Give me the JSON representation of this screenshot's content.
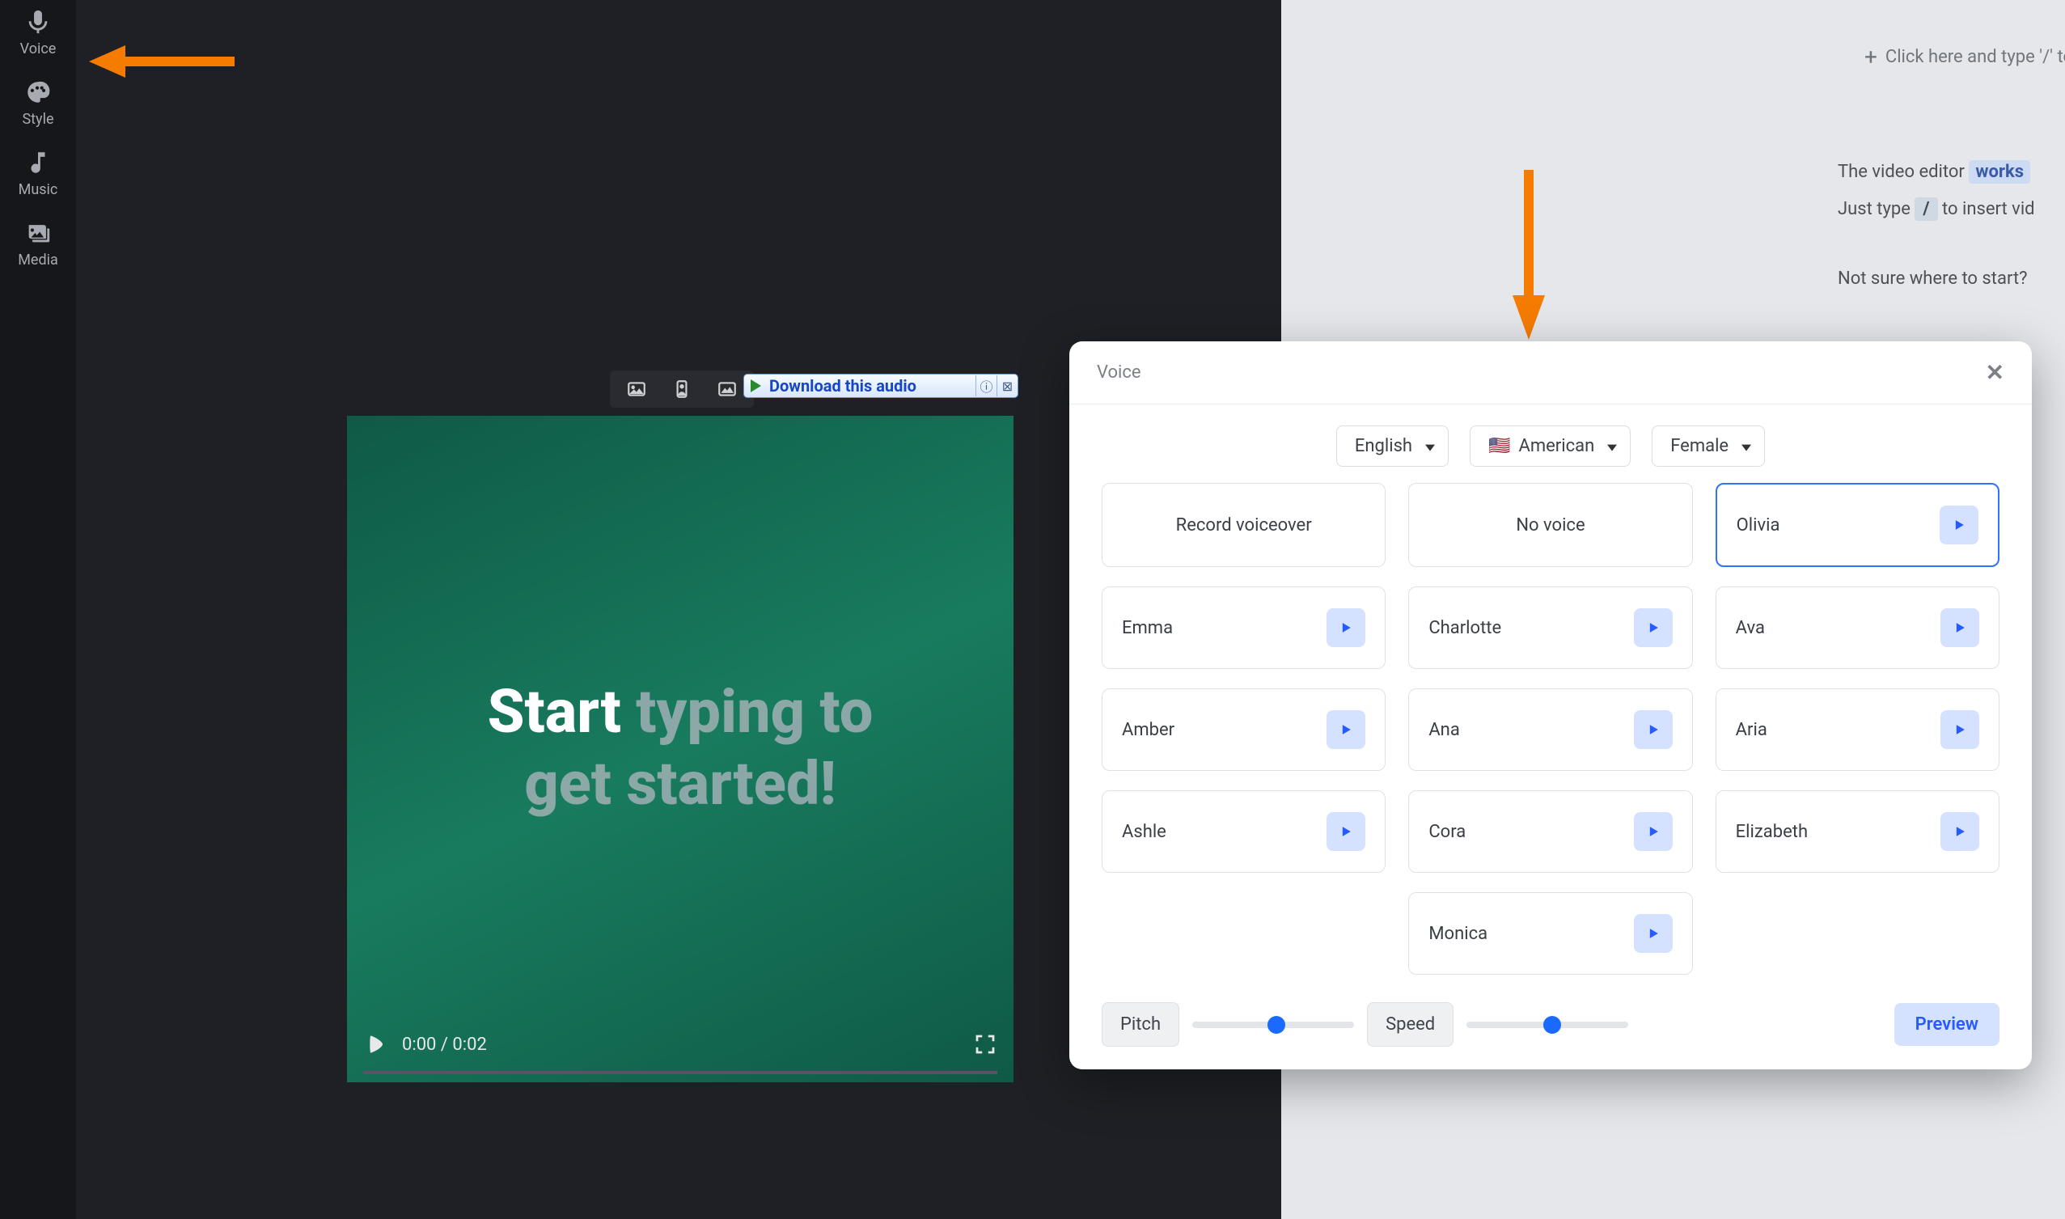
{
  "rail": {
    "voice": "Voice",
    "style": "Style",
    "music": "Music",
    "media": "Media"
  },
  "toolbar": {
    "download_audio": "Download this audio"
  },
  "preview": {
    "line_bold": "Start",
    "line_ghost1": "typing to",
    "line_ghost2": "get started!",
    "time_current": "0:00",
    "time_total": "0:02"
  },
  "type_hint": "Click here and type '/' to",
  "doc": {
    "intro": "The video editor",
    "intro_chip": "works",
    "line2a": "Just type",
    "slash": "/",
    "line2b": "to insert vid",
    "line3": "Not sure where to start?"
  },
  "modal": {
    "title": "Voice",
    "selectors": {
      "language": "English",
      "accent": "American",
      "gender": "Female"
    },
    "options": {
      "record": "Record voiceover",
      "none": "No voice"
    },
    "voices": [
      {
        "name": "Olivia",
        "selected": true
      },
      {
        "name": "Emma",
        "selected": false
      },
      {
        "name": "Charlotte",
        "selected": false
      },
      {
        "name": "Ava",
        "selected": false
      },
      {
        "name": "Amber",
        "selected": false
      },
      {
        "name": "Ana",
        "selected": false
      },
      {
        "name": "Aria",
        "selected": false
      },
      {
        "name": "Ashle",
        "selected": false
      },
      {
        "name": "Cora",
        "selected": false
      },
      {
        "name": "Elizabeth",
        "selected": false
      },
      {
        "name": "Monica",
        "selected": false
      }
    ],
    "foot": {
      "pitch_label": "Pitch",
      "speed_label": "Speed",
      "preview": "Preview",
      "pitch_pos": 0.52,
      "speed_pos": 0.53
    }
  }
}
